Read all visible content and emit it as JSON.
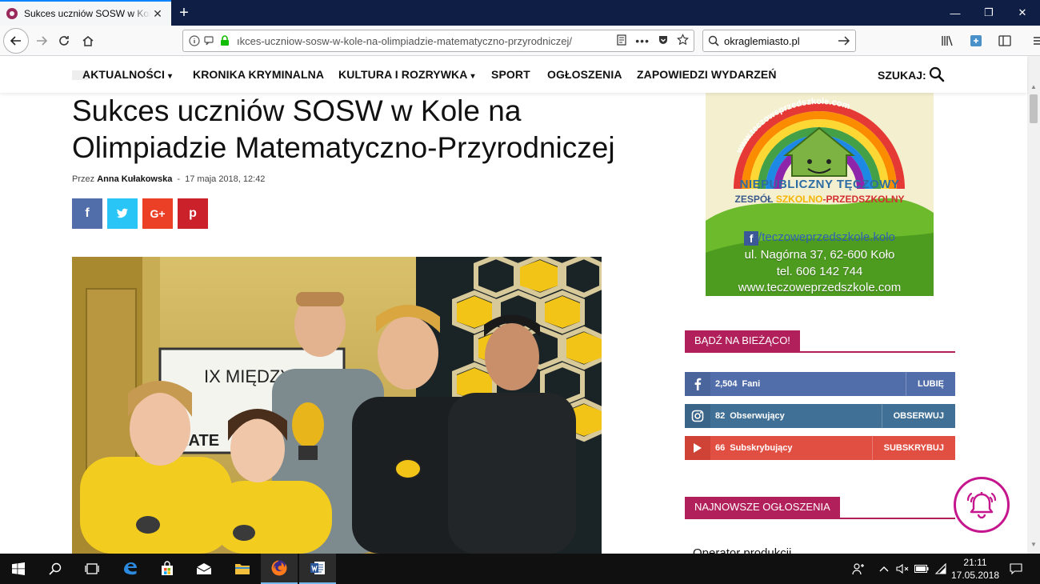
{
  "browser": {
    "tab_title": "Sukces uczniów SOSW w Kole na Olimpiadzie Matematyczno-Przyrodniczej",
    "tab_close": "✕",
    "new_tab": "+",
    "url": "ıkces-uczniow-sosw-w-kole-na-olimpiadzie-matematyczno-przyrodniczej/",
    "search_value": "okraglemiasto.pl",
    "window_controls": {
      "minimize": "—",
      "restore": "❐",
      "close": "✕"
    }
  },
  "site_nav": {
    "items": [
      {
        "label": "AKTUALNOŚCI",
        "has_dropdown": true
      },
      {
        "label": "KRONIKA KRYMINALNA",
        "has_dropdown": false
      },
      {
        "label": "KULTURA I ROZRYWKA",
        "has_dropdown": true
      },
      {
        "label": "SPORT",
        "has_dropdown": false
      },
      {
        "label": "OGŁOSZENIA",
        "has_dropdown": false
      },
      {
        "label": "ZAPOWIEDZI WYDARZEŃ",
        "has_dropdown": false
      }
    ],
    "chevron": "⌄",
    "search_label": "SZUKAJ:"
  },
  "article": {
    "title": "Sukces uczniów SOSW w Kole na Olimpiadzie Matematyczno-Przyrodniczej",
    "by_prefix": "Przez",
    "author": "Anna Kułakowska",
    "separator": "-",
    "date": "17 maja 2018, 12:42",
    "share": {
      "facebook": "f",
      "twitter": "t",
      "googleplus": "G+",
      "pinterest": "p"
    },
    "photo_banner_text": "IX MIĘDZY",
    "photo_banner_text2": "IATE"
  },
  "ad": {
    "arc_text": "www.teczoweprzedszkole.com",
    "name_line1": "NIEPUBLICZNY TĘCZOWY",
    "name_line2_a": "ZESPÓŁ ",
    "name_line2_b": "SZKOLNO",
    "name_line2_c": "-PRZEDSZKOLNY",
    "facebook": "/teczoweprzedszkole.kolo",
    "address": "ul. Nagórna 37, 62-600 Koło",
    "phone": "tel. 606 142 744",
    "website": "www.teczoweprzedszkole.com"
  },
  "sidebar": {
    "stay_updated_title": "BĄDŹ NA BIEŻĄCO!",
    "social": [
      {
        "network": "facebook",
        "count": "2,504",
        "label": "Fani",
        "action": "LUBIĘ",
        "color": "#516eab"
      },
      {
        "network": "instagram",
        "count": "82",
        "label": "Obserwujący",
        "action": "OBSERWUJ",
        "color": "#417096"
      },
      {
        "network": "youtube",
        "count": "66",
        "label": "Subskrybujący",
        "action": "SUBSKRYBUJ",
        "color": "#e14e42"
      }
    ],
    "latest_ads_title": "NAJNOWSZE OGŁOSZENIA",
    "latest_ads_first": "Operator produkcji"
  },
  "taskbar": {
    "time": "21:11",
    "date": "17.05.2018"
  },
  "colors": {
    "accent": "#b1205b",
    "bell": "#c6168d",
    "tab_strip": "#0e1e45"
  }
}
